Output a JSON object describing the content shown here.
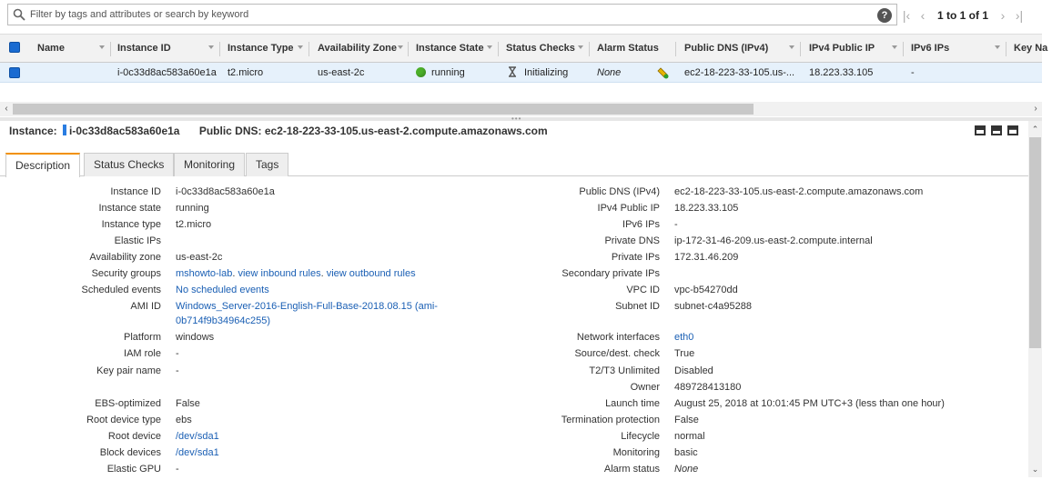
{
  "filter": {
    "placeholder": "Filter by tags and attributes or search by keyword"
  },
  "pager": {
    "text": "1 to 1 of 1"
  },
  "table": {
    "columns": [
      "Name",
      "Instance ID",
      "Instance Type",
      "Availability Zone",
      "Instance State",
      "Status Checks",
      "Alarm Status",
      "Public DNS (IPv4)",
      "IPv4 Public IP",
      "IPv6 IPs",
      "Key Na"
    ],
    "row": {
      "name": "",
      "instance_id": "i-0c33d8ac583a60e1a",
      "instance_type": "t2.micro",
      "availability_zone": "us-east-2c",
      "instance_state": "running",
      "status_checks": "Initializing",
      "alarm_status": "None",
      "public_dns": "ec2-18-223-33-105.us-...",
      "ipv4_public_ip": "18.223.33.105",
      "ipv6_ips": "-"
    }
  },
  "detail": {
    "instance_label": "Instance:",
    "instance_id": "i-0c33d8ac583a60e1a",
    "public_dns_label": "Public DNS:",
    "public_dns": "ec2-18-223-33-105.us-east-2.compute.amazonaws.com"
  },
  "tabs": [
    "Description",
    "Status Checks",
    "Monitoring",
    "Tags"
  ],
  "description": {
    "left": [
      {
        "k": "Instance ID",
        "v": "i-0c33d8ac583a60e1a"
      },
      {
        "k": "Instance state",
        "v": "running"
      },
      {
        "k": "Instance type",
        "v": "t2.micro"
      },
      {
        "k": "Elastic IPs",
        "v": ""
      },
      {
        "k": "Availability zone",
        "v": "us-east-2c"
      },
      {
        "k": "Security groups",
        "v1": "mshowto-lab",
        "v2": "view inbound rules",
        "v3": "view outbound rules"
      },
      {
        "k": "Scheduled events",
        "v": "No scheduled events"
      },
      {
        "k": "AMI ID",
        "v": "Windows_Server-2016-English-Full-Base-2018.08.15 (ami-",
        "v_cont": "0b714f9b34964c255)"
      },
      {
        "k": "Platform",
        "v": "windows"
      },
      {
        "k": "IAM role",
        "v": "-"
      },
      {
        "k": "Key pair name",
        "v": "-"
      },
      {
        "k": "EBS-optimized",
        "v": "False"
      },
      {
        "k": "Root device type",
        "v": "ebs"
      },
      {
        "k": "Root device",
        "v": "/dev/sda1"
      },
      {
        "k": "Block devices",
        "v": "/dev/sda1"
      },
      {
        "k": "Elastic GPU",
        "v": "-"
      }
    ],
    "right": [
      {
        "k": "Public DNS (IPv4)",
        "v": "ec2-18-223-33-105.us-east-2.compute.amazonaws.com"
      },
      {
        "k": "IPv4 Public IP",
        "v": "18.223.33.105"
      },
      {
        "k": "IPv6 IPs",
        "v": "-"
      },
      {
        "k": "Private DNS",
        "v": "ip-172-31-46-209.us-east-2.compute.internal"
      },
      {
        "k": "Private IPs",
        "v": "172.31.46.209"
      },
      {
        "k": "Secondary private IPs",
        "v": ""
      },
      {
        "k": "VPC ID",
        "v": "vpc-b54270dd"
      },
      {
        "k": "Subnet ID",
        "v": "subnet-c4a95288"
      },
      {
        "k": "Network interfaces",
        "v": "eth0"
      },
      {
        "k": "Source/dest. check",
        "v": "True"
      },
      {
        "k": "T2/T3 Unlimited",
        "v": "Disabled"
      },
      {
        "k": "Owner",
        "v": "489728413180"
      },
      {
        "k": "Launch time",
        "v": "August 25, 2018 at 10:01:45 PM UTC+3 (less than one hour)"
      },
      {
        "k": "Termination protection",
        "v": "False"
      },
      {
        "k": "Lifecycle",
        "v": "normal"
      },
      {
        "k": "Monitoring",
        "v": "basic"
      },
      {
        "k": "Alarm status",
        "v": "None"
      }
    ]
  },
  "colors": {
    "accent": "#f29100",
    "link": "#1a5fb4",
    "checkbox": "#1a6bd1",
    "running": "#4caf29",
    "selected_row": "#e6f1fb"
  }
}
